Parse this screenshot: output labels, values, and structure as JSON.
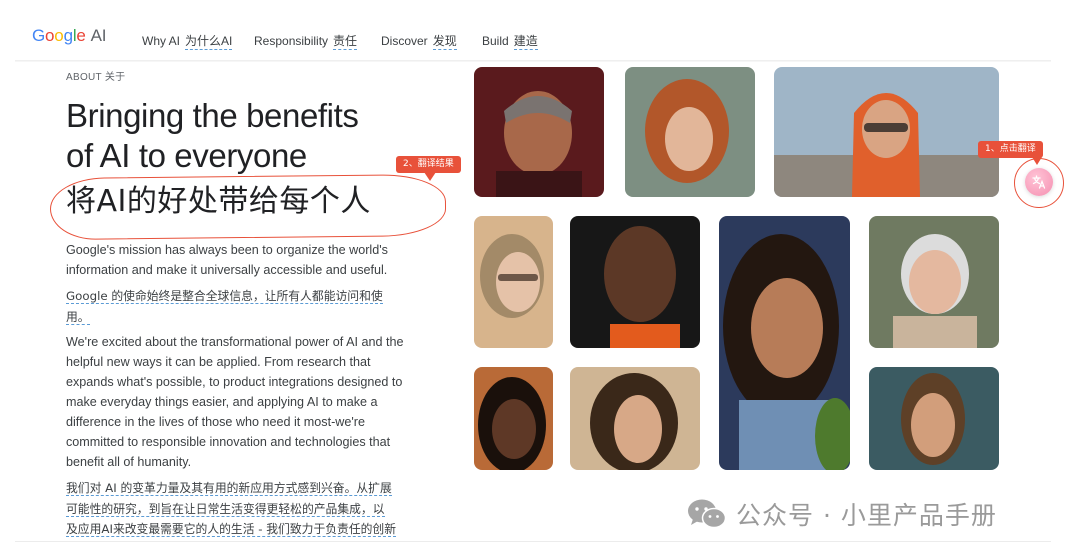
{
  "nav": {
    "logo_letters": [
      "G",
      "o",
      "o",
      "g",
      "l",
      "e"
    ],
    "logo_suffix": "AI",
    "items": [
      {
        "en": "Why AI",
        "zh": "为什么AI"
      },
      {
        "en": "Responsibility",
        "zh": "责任"
      },
      {
        "en": "Discover",
        "zh": "发现"
      },
      {
        "en": "Build",
        "zh": "建造"
      }
    ]
  },
  "hero": {
    "eyebrow": "ABOUT 关于",
    "headline_line1": "Bringing the benefits",
    "headline_line2": "of AI to everyone",
    "headline_zh": "将AI的好处带给每个人",
    "mission_en_1": "Google's mission has always been to organize the world's",
    "mission_en_2": "information and make it universally accessible and useful.",
    "mission_zh_1": "Google 的使命始终是整合全球信息，让所有人都能访问和使",
    "mission_zh_2": "用。",
    "excited_en": [
      "We're excited about the transformational power of AI and the",
      "helpful new ways it can be applied. From research that",
      "expands what's possible, to product integrations designed to",
      "make everyday things easier, and applying AI to make a",
      "difference in the lives of those who need it most-we're",
      "committed to responsible innovation and technologies that",
      "benefit all of humanity."
    ],
    "excited_zh": [
      "我们对 AI 的变革力量及其有用的新应用方式感到兴奋。从扩展",
      "可能性的研究，到旨在让日常生活变得更轻松的产品集成，以",
      "及应用AI来改变最需要它的人的生活 - 我们致力于负责任的创新"
    ]
  },
  "annotations": {
    "translate_result": "2、翻译结果",
    "click_translate": "1、点击翻译"
  },
  "watermark": {
    "text": "公众号 · 小里产品手册"
  },
  "colors": {
    "accent_red": "#e8513a",
    "dashed_underline": "#5b9bd5",
    "translate_pink": "#f58fb1"
  }
}
